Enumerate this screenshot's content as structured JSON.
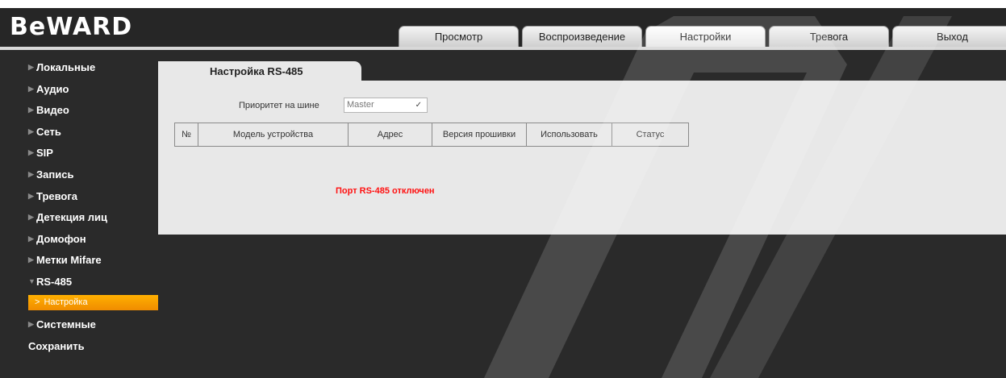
{
  "brand": {
    "logo": "BeWARD"
  },
  "nav": {
    "tabs": [
      {
        "label": "Просмотр"
      },
      {
        "label": "Воспроизведение"
      },
      {
        "label": "Настройки"
      },
      {
        "label": "Тревога"
      },
      {
        "label": "Выход"
      }
    ],
    "active": "Настройки"
  },
  "sidebar": {
    "items": [
      {
        "label": "Локальные"
      },
      {
        "label": "Аудио"
      },
      {
        "label": "Видео"
      },
      {
        "label": "Сеть"
      },
      {
        "label": "SIP"
      },
      {
        "label": "Запись"
      },
      {
        "label": "Тревога"
      },
      {
        "label": "Детекция лиц"
      },
      {
        "label": "Домофон"
      },
      {
        "label": "Метки Mifare"
      },
      {
        "label": "RS-485"
      },
      {
        "label": "Системные"
      },
      {
        "label": "Сохранить"
      }
    ],
    "expanded": "RS-485",
    "sub_item": {
      "label": "Настройка"
    }
  },
  "content": {
    "tab_title": "Настройка RS-485",
    "priority": {
      "label": "Приоритет на шине",
      "value": "Master"
    },
    "table": {
      "headers": [
        "№",
        "Модель устройства",
        "Адрес",
        "Версия прошивки",
        "Использовать",
        "Статус"
      ]
    },
    "status_message": "Порт RS-485 отключен"
  },
  "colors": {
    "background": "#2a2a2a",
    "panel": "#e8e8e8",
    "accent": "#f5a000",
    "error": "#ff1010"
  }
}
